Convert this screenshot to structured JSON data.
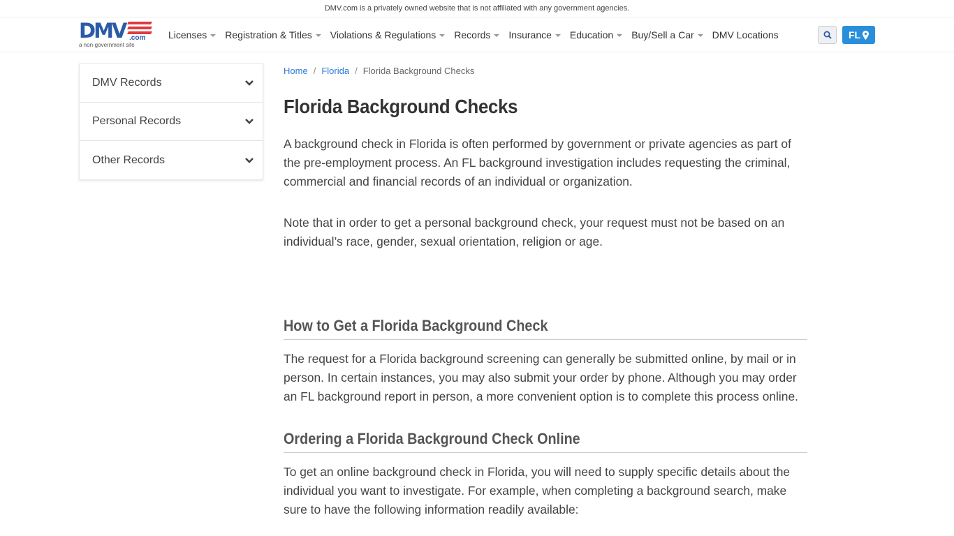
{
  "topbar": {
    "disclaimer": "DMV.com is a privately owned website that is not affiliated with any government agencies."
  },
  "logo": {
    "brand": "DMV",
    "suffix": ".com",
    "tagline": "a non-government site"
  },
  "nav": {
    "items": [
      {
        "label": "Licenses",
        "dropdown": true
      },
      {
        "label": "Registration & Titles",
        "dropdown": true
      },
      {
        "label": "Violations & Regulations",
        "dropdown": true
      },
      {
        "label": "Records",
        "dropdown": true
      },
      {
        "label": "Insurance",
        "dropdown": true
      },
      {
        "label": "Education",
        "dropdown": true
      },
      {
        "label": "Buy/Sell a Car",
        "dropdown": true
      },
      {
        "label": "DMV Locations",
        "dropdown": false
      }
    ],
    "search_icon": "search-icon",
    "state_label": "FL",
    "state_icon": "map-marker-icon"
  },
  "sidebar": {
    "items": [
      {
        "label": "DMV Records"
      },
      {
        "label": "Personal Records"
      },
      {
        "label": "Other Records"
      }
    ]
  },
  "breadcrumb": {
    "home": "Home",
    "state": "Florida",
    "current": "Florida Background Checks",
    "separator": "/"
  },
  "article": {
    "title": "Florida Background Checks",
    "intro": "A background check in Florida is often performed by government or private agencies as part of the pre-employment process. An FL background investigation includes requesting the criminal, commercial and financial records of an individual or organization.",
    "note": "Note that in order to get a personal background check, your request must not be based on an individual’s race, gender, sexual orientation, religion or age.",
    "section1_title": "How to Get a Florida Background Check",
    "section1_body": "The request for a Florida background screening can generally be submitted online, by mail or in person. In certain instances, you may also submit your order by phone. Although you may order an FL background report in person, a more convenient option is to complete this process online.",
    "section2_title": "Ordering a Florida Background Check Online",
    "section2_body": "To get an online background check in Florida, you will need to supply specific details about the individual you want to investigate. For example, when completing a background search, make sure to have the following information readily available:"
  },
  "colors": {
    "brand_blue": "#2b5aa8",
    "brand_red": "#e03a3e",
    "link": "#2a7ad9",
    "state_button": "#2a8fdb"
  }
}
